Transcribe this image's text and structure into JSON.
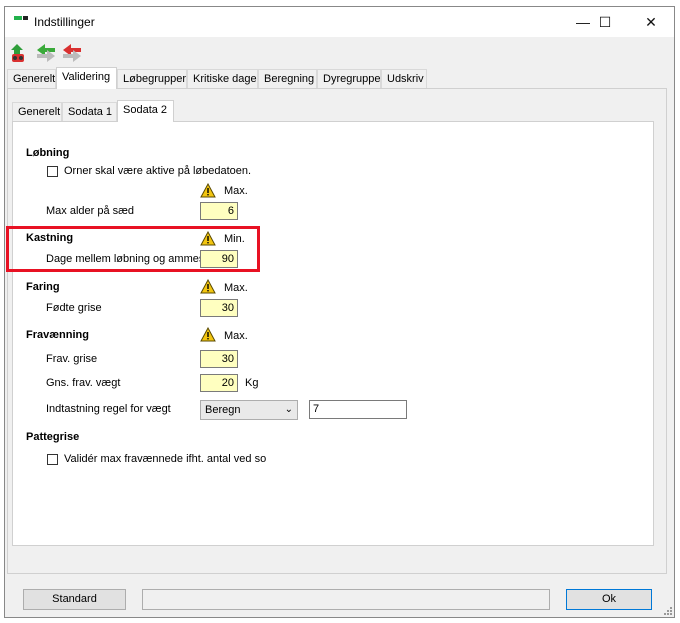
{
  "window": {
    "title": "Indstillinger",
    "controls": {
      "minimize": "—",
      "maximize": "☐",
      "close": "✕"
    }
  },
  "toolbar": {
    "icons": [
      "save-icon",
      "forward-arrow-icon",
      "back-arrow-icon"
    ]
  },
  "main_tabs": [
    {
      "label": "Generelt",
      "active": false
    },
    {
      "label": "Validering",
      "active": true
    },
    {
      "label": "Løbegrupper",
      "active": false
    },
    {
      "label": "Kritiske dage",
      "active": false
    },
    {
      "label": "Beregning",
      "active": false
    },
    {
      "label": "Dyregruppe",
      "active": false
    },
    {
      "label": "Udskriv",
      "active": false
    }
  ],
  "sub_tabs": [
    {
      "label": "Generelt",
      "active": false
    },
    {
      "label": "Sodata 1",
      "active": false
    },
    {
      "label": "Sodata 2",
      "active": true
    }
  ],
  "lobning": {
    "title": "Løbning",
    "checkbox_label": "Orner skal være aktive på løbedatoen.",
    "checked": false,
    "limit_caption": "Max.",
    "field_label": "Max alder på sæd",
    "value": "6"
  },
  "kastning": {
    "title": "Kastning",
    "limit_caption": "Min.",
    "field_label": "Dage mellem løbning og ammeso",
    "value": "90"
  },
  "faring": {
    "title": "Faring",
    "limit_caption": "Max.",
    "field_label": "Fødte grise",
    "value": "30"
  },
  "fravaenning": {
    "title": "Fravænning",
    "limit_caption": "Max.",
    "grise_label": "Frav. grise",
    "grise_value": "30",
    "vaegt_label": "Gns. frav. vægt",
    "vaegt_value": "20",
    "vaegt_unit": "Kg",
    "regel_label": "Indtastning regel for vægt",
    "regel_select": "Beregn",
    "regel_value": "7"
  },
  "pattegrise": {
    "title": "Pattegrise",
    "checkbox_label": "Validér max fravænnede ifht. antal ved so",
    "checked": false
  },
  "footer": {
    "standard_label": "Standard",
    "status_text": "",
    "ok_label": "Ok"
  },
  "colors": {
    "highlight": "#e81123",
    "input_bg": "#ffffc0",
    "default_button_border": "#0078d7",
    "warning_fill": "#f2c511"
  }
}
